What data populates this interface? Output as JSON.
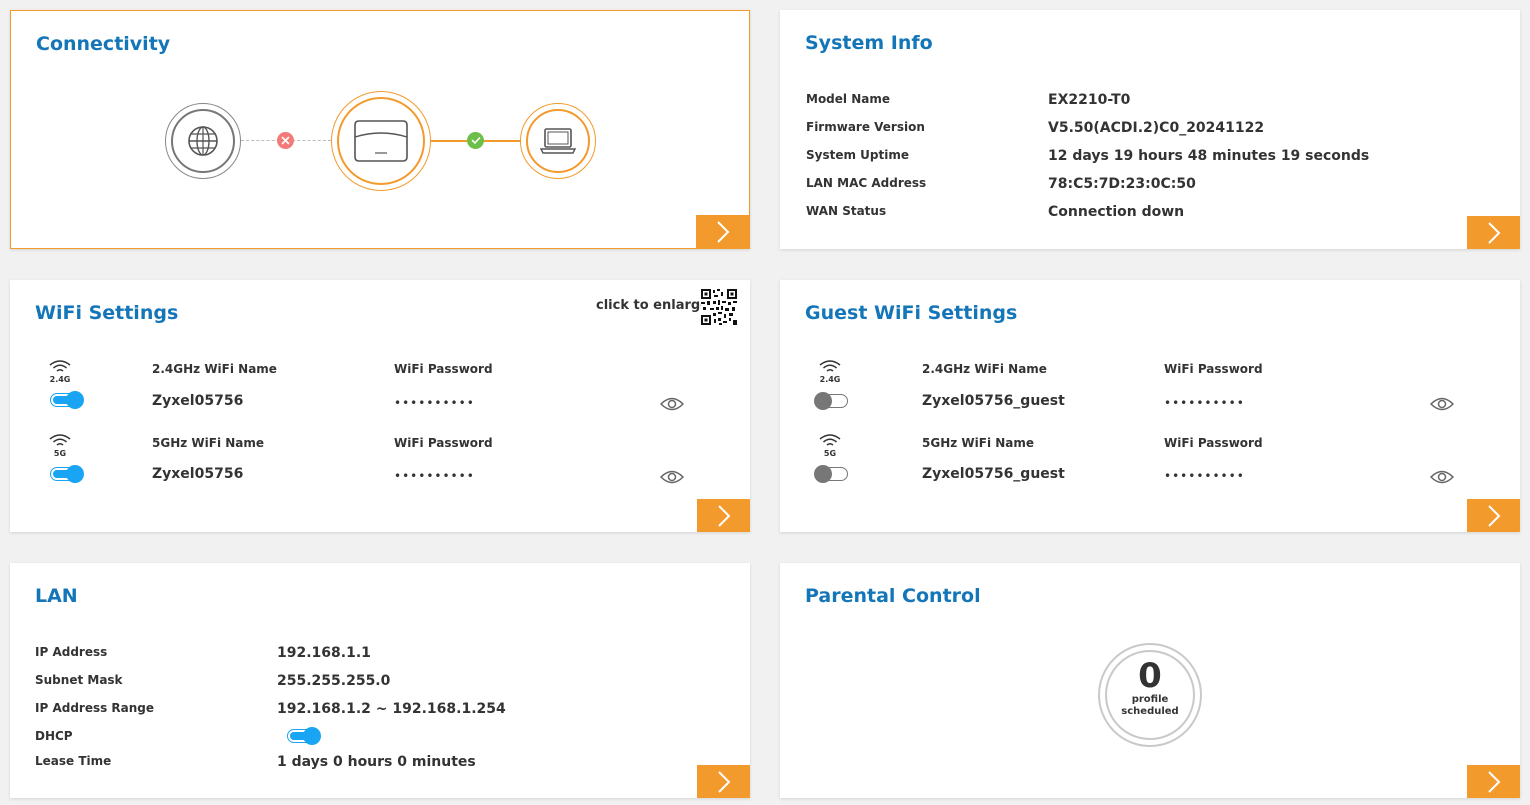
{
  "connectivity": {
    "title": "Connectivity",
    "internet_icon": "globe-icon",
    "router_icon": "router-icon",
    "client_icon": "laptop-icon",
    "wan_status_icon": "x-icon",
    "lan_status_icon": "check-icon",
    "colors": {
      "accent": "#f39a2c",
      "error": "#f47a7a",
      "ok": "#6cc04a"
    }
  },
  "system_info": {
    "title": "System Info",
    "rows": [
      {
        "label": "Model Name",
        "value": "EX2210-T0"
      },
      {
        "label": "Firmware Version",
        "value": "V5.50(ACDI.2)C0_20241122"
      },
      {
        "label": "System Uptime",
        "value": "12 days 19 hours 48 minutes 19 seconds"
      },
      {
        "label": "LAN MAC Address",
        "value": "78:C5:7D:23:0C:50"
      },
      {
        "label": "WAN Status",
        "value": "Connection down"
      }
    ]
  },
  "wifi": {
    "title": "WiFi Settings",
    "qr_note": "click to enlarge",
    "bands": [
      {
        "band": "2.4G",
        "name_label": "2.4GHz WiFi Name",
        "ssid": "Zyxel05756",
        "pw_label": "WiFi Password",
        "pw_mask": "••••••••••",
        "enabled": true
      },
      {
        "band": "5G",
        "name_label": "5GHz WiFi Name",
        "ssid": "Zyxel05756",
        "pw_label": "WiFi Password",
        "pw_mask": "••••••••••",
        "enabled": true
      }
    ]
  },
  "guest_wifi": {
    "title": "Guest WiFi Settings",
    "bands": [
      {
        "band": "2.4G",
        "name_label": "2.4GHz WiFi Name",
        "ssid": "Zyxel05756_guest",
        "pw_label": "WiFi Password",
        "pw_mask": "••••••••••",
        "enabled": false
      },
      {
        "band": "5G",
        "name_label": "5GHz WiFi Name",
        "ssid": "Zyxel05756_guest",
        "pw_label": "WiFi Password",
        "pw_mask": "••••••••••",
        "enabled": false
      }
    ]
  },
  "lan": {
    "title": "LAN",
    "rows": [
      {
        "label": "IP Address",
        "value": "192.168.1.1"
      },
      {
        "label": "Subnet Mask",
        "value": "255.255.255.0"
      },
      {
        "label": "IP Address Range",
        "value": "192.168.1.2 ~ 192.168.1.254"
      },
      {
        "label": "DHCP",
        "value": ""
      },
      {
        "label": "Lease Time",
        "value": "1 days 0 hours 0 minutes"
      }
    ],
    "dhcp_enabled": true
  },
  "parental": {
    "title": "Parental Control",
    "count": "0",
    "line1": "profile",
    "line2": "scheduled"
  }
}
